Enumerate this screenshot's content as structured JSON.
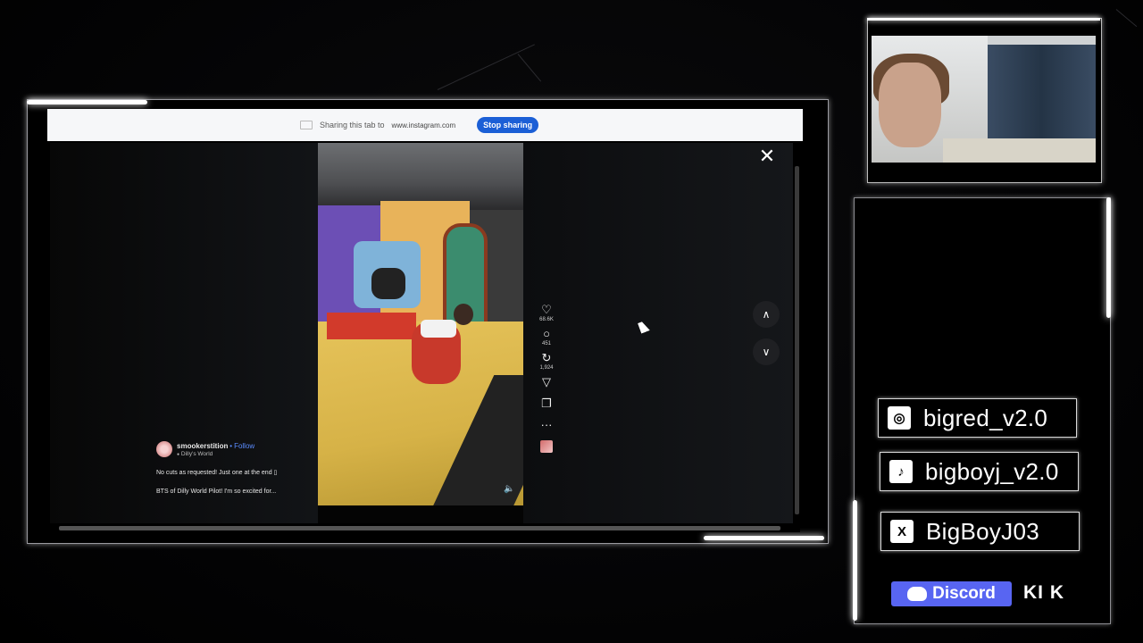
{
  "share_bar": {
    "sharing_text": "Sharing this tab to",
    "sharing_url": "www.instagram.com",
    "stop_label": "Stop sharing"
  },
  "post": {
    "username": "smookerstition",
    "separator": "•",
    "follow_label": "Follow",
    "location": "Dilly's World",
    "caption_line1": "No cuts as requested! Just one at the end ▯",
    "caption_line2": "BTS of Dilly World Pilot! I'm so excited for...",
    "likes": "68.6K",
    "comments": "451",
    "reposts": "1,924"
  },
  "icons": {
    "like": "♡",
    "comment": "○",
    "repost": "↻",
    "share": "▽",
    "save": "❐",
    "more": "···",
    "close": "✕",
    "prev": "∧",
    "next": "∨",
    "mute": "🔈",
    "location_pin": "●"
  },
  "socials": [
    {
      "platform": "instagram",
      "icon": "◎",
      "handle": "bigred_v2.0"
    },
    {
      "platform": "tiktok",
      "icon": "♪",
      "handle": "bigboyj_v2.0"
    },
    {
      "platform": "x",
      "icon": "X",
      "handle": "BigBoyJ03"
    }
  ],
  "discord_label": "Discord",
  "kik_label": "KI K",
  "colors": {
    "stop_button": "#1b5fd6",
    "follow": "#5b8cff",
    "discord": "#5865f2"
  }
}
